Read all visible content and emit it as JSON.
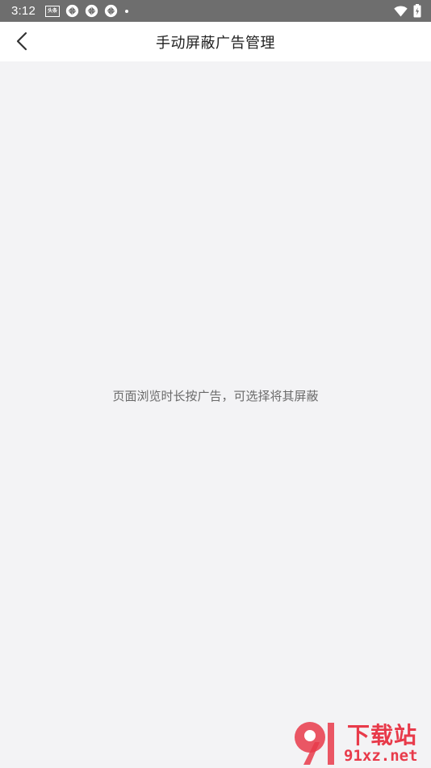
{
  "status_bar": {
    "time": "3:12",
    "news_icon_text": "头条",
    "icons": [
      "news-icon",
      "app-icon",
      "app-icon",
      "app-icon",
      "notification-dot",
      "wifi-icon",
      "battery-icon"
    ]
  },
  "header": {
    "title": "手动屏蔽广告管理",
    "back_icon": "chevron-left-icon"
  },
  "main": {
    "empty_hint": "页面浏览时长按广告，可选择将其屏蔽"
  },
  "watermark": {
    "cn": "下载站",
    "url": "91xz.net",
    "color": "#e83a4a"
  }
}
